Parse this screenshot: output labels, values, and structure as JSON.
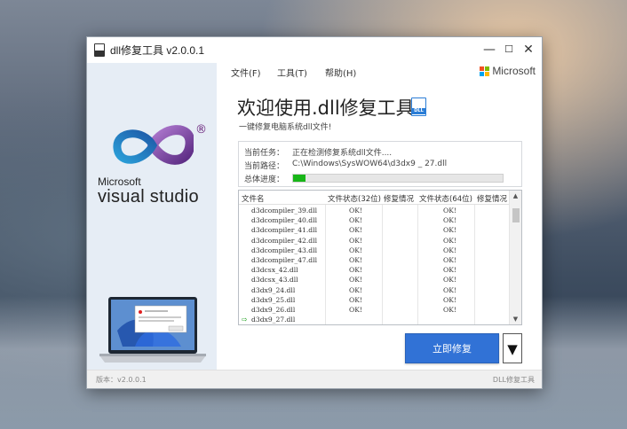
{
  "window": {
    "title": "dll修复工具 v2.0.0.1",
    "controls": {
      "minimize": "—",
      "maximize": "☐",
      "close": "✕"
    }
  },
  "menu": {
    "items": [
      "文件(F)",
      "工具(T)",
      "帮助(H)"
    ]
  },
  "brand": {
    "text": "Microsoft",
    "colors": [
      "#f25022",
      "#7fba00",
      "#00a4ef",
      "#ffb900"
    ]
  },
  "sidebar": {
    "logo_brand": "Microsoft",
    "logo_registered": "®",
    "logo_product": "visual studio"
  },
  "main": {
    "title": "欢迎使用.dll修复工具",
    "title_icon_text": "DLL",
    "subtitle": "一键修复电脑系统dll文件!"
  },
  "status": {
    "task_label": "当前任务：",
    "task_value": "正在检测修复系统dll文件....",
    "path_label": "当前路径：",
    "path_value": "C:\\Windows\\SysWOW64\\d3dx9 _ 27.dll",
    "progress_label": "总体进度：",
    "progress_percent": 6
  },
  "table": {
    "headers": [
      "文件名",
      "文件状态(32位)",
      "修复情况",
      "文件状态(64位)",
      "修复情况"
    ],
    "rows": [
      [
        "d3dcompiler_39.dll",
        "OK!",
        "",
        "OK!",
        ""
      ],
      [
        "d3dcompiler_40.dll",
        "OK!",
        "",
        "OK!",
        ""
      ],
      [
        "d3dcompiler_41.dll",
        "OK!",
        "",
        "OK!",
        ""
      ],
      [
        "d3dcompiler_42.dll",
        "OK!",
        "",
        "OK!",
        ""
      ],
      [
        "d3dcompiler_43.dll",
        "OK!",
        "",
        "OK!",
        ""
      ],
      [
        "d3dcompiler_47.dll",
        "OK!",
        "",
        "OK!",
        ""
      ],
      [
        "d3dcsx_42.dll",
        "OK!",
        "",
        "OK!",
        ""
      ],
      [
        "d3dcsx_43.dll",
        "OK!",
        "",
        "OK!",
        ""
      ],
      [
        "d3dx9_24.dll",
        "OK!",
        "",
        "OK!",
        ""
      ],
      [
        "d3dx9_25.dll",
        "OK!",
        "",
        "OK!",
        ""
      ],
      [
        "d3dx9_26.dll",
        "OK!",
        "",
        "OK!",
        ""
      ],
      [
        "d3dx9_27.dll",
        "",
        "",
        "",
        ""
      ]
    ],
    "current_row_marker": "⇨",
    "scroll_up": "▲",
    "scroll_down": "▼"
  },
  "actions": {
    "repair_label": "立即修复",
    "dropdown_label": "▼"
  },
  "footer": {
    "version": "版本：v2.0.0.1",
    "app_name": "DLL修复工具"
  }
}
